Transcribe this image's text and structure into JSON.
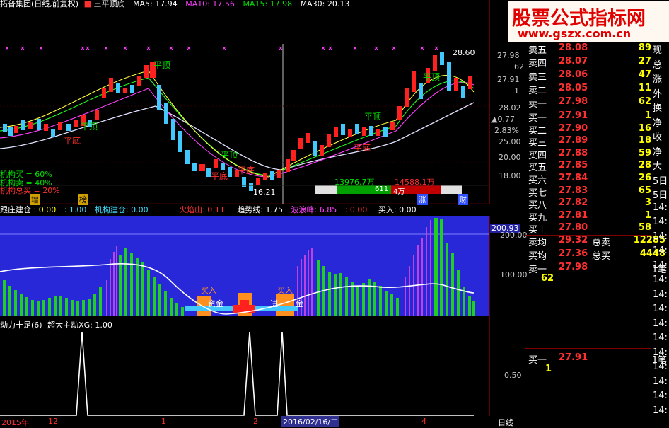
{
  "watermark": {
    "title": "股票公式指标网",
    "url": "www.gszx.com.cn"
  },
  "main_chart": {
    "header": {
      "name": "拓普集团(日线,前复权)",
      "indicator": "三平顶底",
      "ma5": "MA5: 17.94",
      "ma10": "MA10: 17.56",
      "ma15": "MA15: 17.98",
      "ma30": "MA30: 20.13"
    },
    "price_axis": [
      "27.98",
      "62",
      "27.91",
      "1",
      "28.02",
      "▲0.77",
      "2.83%",
      "25.00",
      "20.00",
      "18.00"
    ],
    "signals": [
      "平顶",
      "平顶",
      "平顶",
      "平底",
      "平底",
      "平底",
      "平顶",
      "平底",
      "平顶"
    ],
    "annotations": {
      "inst_buy": "机构买 = 60%",
      "inst_sell": "机构卖 = 40%",
      "inst_total": "机构总买 = 20%",
      "low_price": "16.21",
      "peak_label": "28.60",
      "zeng": "增",
      "zhang": "涨",
      "cai": "财",
      "bang": "榜"
    },
    "volume_bar": {
      "left": "13976.7万",
      "right": "14588.1万",
      "mid_left": "611",
      "mid_right": "4万"
    }
  },
  "indicator_panel_1": {
    "header": {
      "a": "跟庄建仓",
      "a_val": ": 0.00",
      "b_val": ": 1.00",
      "c": "机构建仓: 0.00",
      "d": "火焰山: 0.11",
      "e": "趋势线: 1.75",
      "f": "波浪峰: 6.85",
      "g": ": 0.00",
      "h": "买入: 0.00"
    },
    "axis": [
      "200.93",
      "200.00",
      "100.00"
    ],
    "labels": {
      "buy1": "买入",
      "buy2": "买入",
      "fund1": "资金",
      "fund2": "进",
      "fund3": "金"
    }
  },
  "indicator_panel_2": {
    "header": {
      "a": "动力十足(6)",
      "b": "超大主动XG: 1.00"
    },
    "axis": [
      "0.50"
    ]
  },
  "x_axis": {
    "labels": [
      "2015年",
      "12",
      "1",
      "2",
      "2016/02/16/二",
      "4"
    ],
    "period": "日线"
  },
  "order_book": {
    "sells": [
      {
        "label": "卖五",
        "price": "28.08",
        "vol": "89"
      },
      {
        "label": "卖四",
        "price": "28.07",
        "vol": "27"
      },
      {
        "label": "卖三",
        "price": "28.06",
        "vol": "47"
      },
      {
        "label": "卖二",
        "price": "28.05",
        "vol": "11"
      },
      {
        "label": "卖一",
        "price": "27.98",
        "vol": "62"
      }
    ],
    "buys": [
      {
        "label": "买一",
        "price": "27.91",
        "vol": "1"
      },
      {
        "label": "买二",
        "price": "27.90",
        "vol": "16"
      },
      {
        "label": "买三",
        "price": "27.89",
        "vol": "18"
      },
      {
        "label": "买四",
        "price": "27.88",
        "vol": "59"
      },
      {
        "label": "买五",
        "price": "27.85",
        "vol": "28"
      },
      {
        "label": "买六",
        "price": "27.84",
        "vol": "26"
      },
      {
        "label": "买七",
        "price": "27.83",
        "vol": "65"
      },
      {
        "label": "买八",
        "price": "27.82",
        "vol": "3"
      },
      {
        "label": "买九",
        "price": "27.81",
        "vol": "1"
      },
      {
        "label": "买十",
        "price": "27.80",
        "vol": "58"
      }
    ],
    "summary": {
      "sell_avg_lbl": "卖均",
      "sell_avg": "29.32",
      "total_sell_lbl": "总卖",
      "total_sell": "12285",
      "buy_avg_lbl": "买均",
      "buy_avg": "27.36",
      "total_buy_lbl": "总买",
      "total_buy": "4448"
    },
    "tick1": {
      "label": "卖一",
      "price": "27.98",
      "unit": "1笔",
      "vol": "62"
    },
    "tick2": {
      "label": "买一",
      "price": "27.91",
      "unit": "1笔",
      "vol": "1"
    }
  },
  "right_strip": [
    "现",
    "总",
    "涨",
    "外",
    "换",
    "净",
    "收",
    "净",
    "大",
    "5日",
    "5日",
    "14:",
    "14:",
    "14:",
    "14:",
    "14:",
    "14:",
    "14:",
    "14:",
    "14:",
    "14:",
    "14:",
    "14:",
    "14:",
    "14:",
    "14:"
  ],
  "colors": {
    "up": "#ff2020",
    "down": "#40c8ff",
    "panel_bg": "#2020d0",
    "accent": "#ff0000"
  }
}
